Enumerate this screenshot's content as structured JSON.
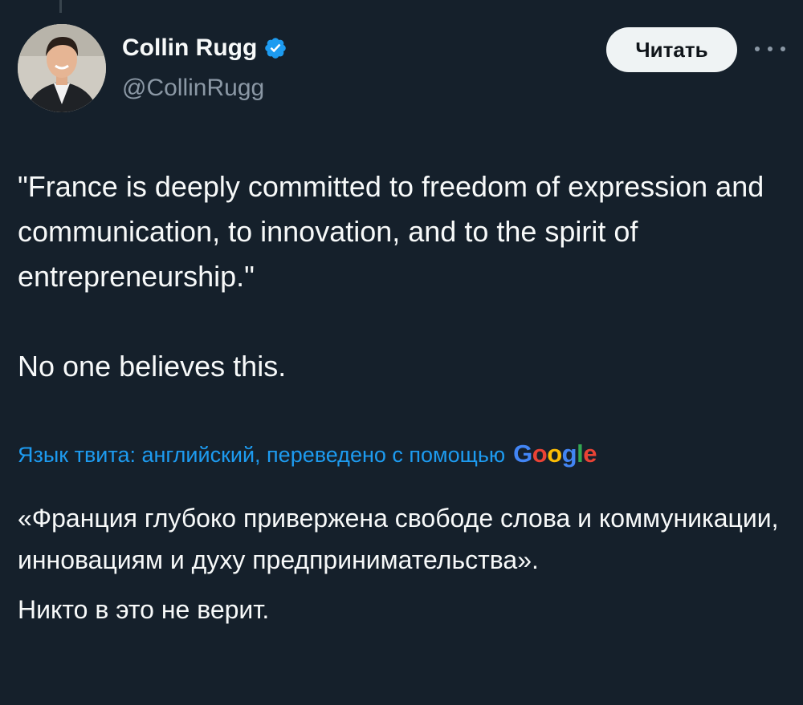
{
  "author": {
    "name": "Collin Rugg",
    "handle": "@CollinRugg",
    "verified_color": "#1d9bf0"
  },
  "actions": {
    "follow_label": "Читать",
    "more_icon": "more-horizontal-icon"
  },
  "tweet": {
    "paragraphs": [
      "\"France is deeply committed to freedom of expression and communication, to innovation, and to the spirit of entrepreneurship.\"",
      "No one believes this."
    ]
  },
  "translation": {
    "label": "Язык твита: английский, переведено с помощью",
    "provider": {
      "letters": [
        "G",
        "o",
        "o",
        "g",
        "l",
        "e"
      ],
      "colors": [
        "#4285f4",
        "#ea4335",
        "#fbbc05",
        "#4285f4",
        "#34a853",
        "#ea4335"
      ]
    },
    "paragraphs": [
      "«Франция глубоко привержена свободе слова и коммуникации, инновациям и духу предпринимательства».",
      "Никто в это не верит."
    ]
  },
  "colors": {
    "background": "#15202b",
    "text_primary": "#f7f9f9",
    "text_secondary": "#8b98a5",
    "accent": "#1d9bf0"
  }
}
